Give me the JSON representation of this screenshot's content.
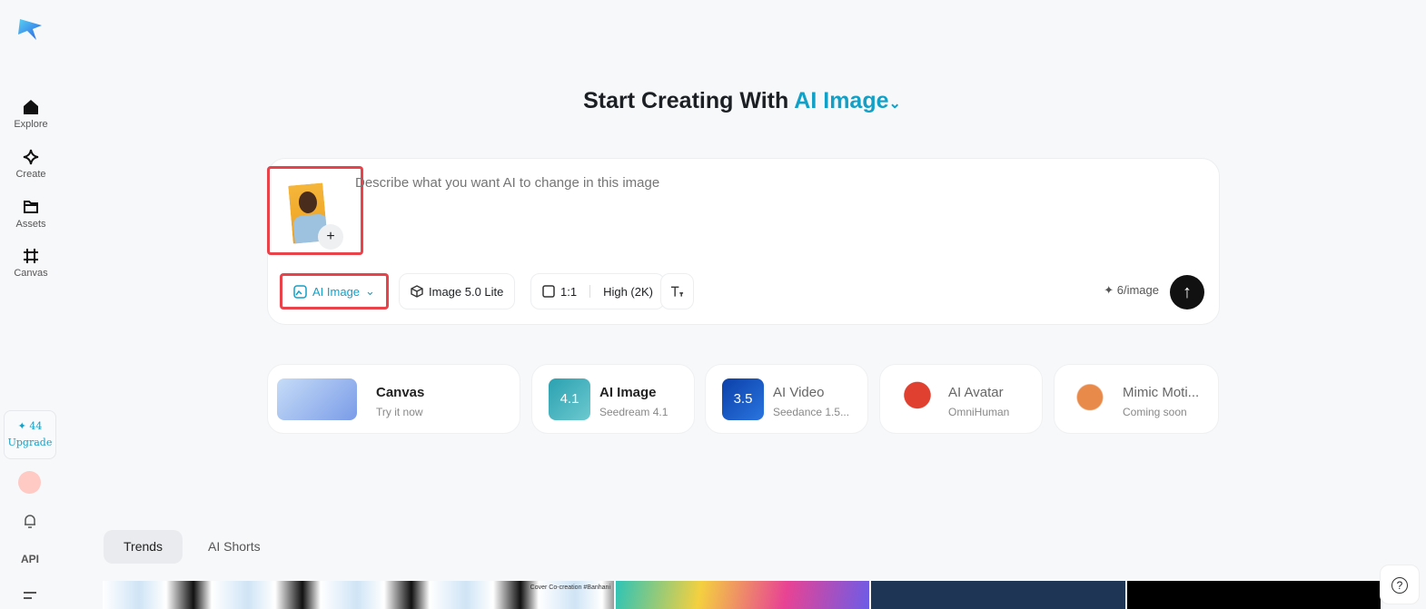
{
  "sidebar": {
    "items": [
      {
        "label": "Explore",
        "icon": "home-icon"
      },
      {
        "label": "Create",
        "icon": "diamond-icon"
      },
      {
        "label": "Assets",
        "icon": "folder-icon"
      },
      {
        "label": "Canvas",
        "icon": "canvas-icon"
      }
    ],
    "credits": "✦ 44",
    "upgrade": "Upgrade",
    "api": "API"
  },
  "header": {
    "title": "Start Creating With",
    "mode": "AI Image",
    "chevron": "⌄"
  },
  "prompt": {
    "placeholder": "Describe what you want AI to change in this image",
    "add": "+",
    "mode": "AI Image",
    "model": "Image 5.0 Lite",
    "ratio": "1:1",
    "quality": "High (2K)",
    "cost": "✦ 6/image",
    "send": "↑"
  },
  "cards": [
    {
      "title": "Canvas",
      "subtitle": "Try it now"
    },
    {
      "title": "AI Image",
      "subtitle": "Seedream 4.1",
      "badge": "4.1"
    },
    {
      "title": "AI Video",
      "subtitle": "Seedance 1.5...",
      "badge": "3.5"
    },
    {
      "title": "AI Avatar",
      "subtitle": "OmniHuman"
    },
    {
      "title": "Mimic Moti...",
      "subtitle": "Coming soon"
    }
  ],
  "tabs": [
    "Trends",
    "AI Shorts"
  ],
  "gallery": {
    "caption": "Cover Co-creation #Banhani"
  },
  "help": "?",
  "colors": {
    "accent": "#13a0c6",
    "highlight": "#e8434a"
  }
}
